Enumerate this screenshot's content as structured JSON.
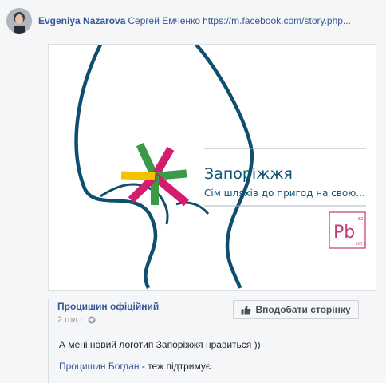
{
  "post": {
    "author": "Evgeniya Nazarova",
    "mention": "Сергей Емченко",
    "link": "https://m.facebook.com/story.php..."
  },
  "media": {
    "title": "Запоріжжя",
    "subtitle": "Сім шляхів до пригод на свою...",
    "badge": {
      "logo": "Pb",
      "top_num": "82",
      "bottom_num": "207.2"
    },
    "colors": {
      "curve": "#0e4e6e",
      "green": "#3a9a48",
      "yellow": "#f2c400",
      "pink": "#d41e6d",
      "text": "#0d5476",
      "badge": "#c63a73"
    }
  },
  "shared": {
    "page_name": "Процишин офіційний",
    "time": "2 год",
    "like_page_label": "Вподобати сторінку",
    "text": "А мені новий логотип Запоріжжя нравиться ))",
    "comment_author": "Процишин Богдан",
    "comment_text": " - теж підтримує"
  },
  "icons": {
    "avatar": "profile-photo",
    "privacy": "globe-icon",
    "like": "thumbs-up-icon"
  }
}
